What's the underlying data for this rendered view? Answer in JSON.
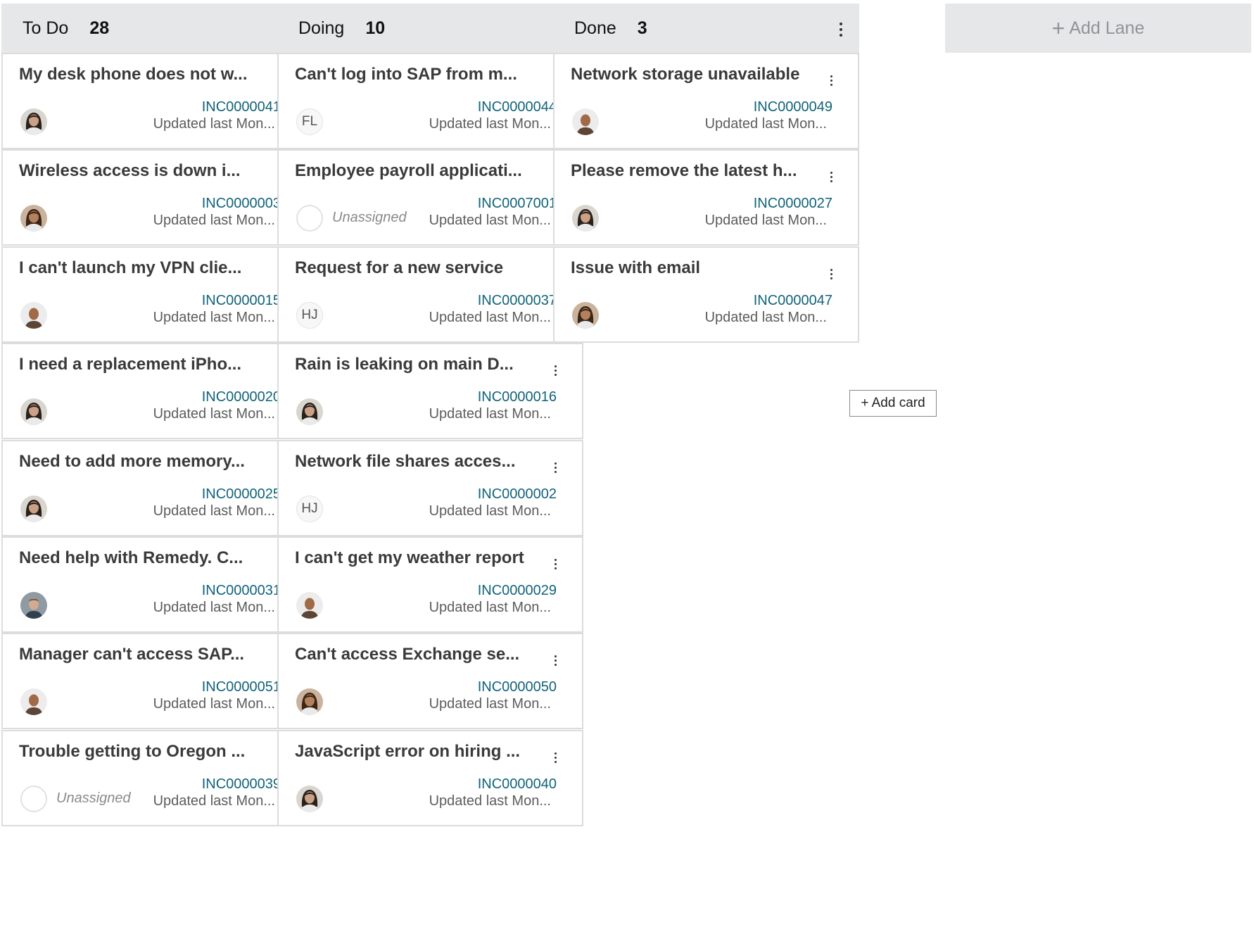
{
  "lanes": [
    {
      "title": "To Do",
      "count": "28",
      "cards": [
        {
          "title": "My desk phone does not w...",
          "number": "INC0000041",
          "updated": "Updated last Mon...",
          "avatar": {
            "type": "photo",
            "face": "woman-dark-hair"
          }
        },
        {
          "title": "Wireless access is down i...",
          "number": "INC0000003",
          "updated": "Updated last Mon...",
          "avatar": {
            "type": "photo",
            "face": "woman-smiling"
          }
        },
        {
          "title": "I can't launch my VPN clie...",
          "number": "INC0000015",
          "updated": "Updated last Mon...",
          "avatar": {
            "type": "photo",
            "face": "man-bald"
          }
        },
        {
          "title": "I need a replacement iPho...",
          "number": "INC0000020",
          "updated": "Updated last Mon...",
          "avatar": {
            "type": "photo",
            "face": "woman-dark-hair"
          }
        },
        {
          "title": "Need to add more memory...",
          "number": "INC0000025",
          "updated": "Updated last Mon...",
          "avatar": {
            "type": "photo",
            "face": "woman-dark-hair"
          }
        },
        {
          "title": "Need help with Remedy. C...",
          "number": "INC0000031",
          "updated": "Updated last Mon...",
          "avatar": {
            "type": "photo",
            "face": "man-suit"
          }
        },
        {
          "title": "Manager can't access SAP...",
          "number": "INC0000051",
          "updated": "Updated last Mon...",
          "avatar": {
            "type": "photo",
            "face": "man-bald"
          }
        },
        {
          "title": "Trouble getting to Oregon ...",
          "number": "INC0000039",
          "updated": "Updated last Mon...",
          "avatar": {
            "type": "unassigned",
            "label": "Unassigned"
          }
        }
      ]
    },
    {
      "title": "Doing",
      "count": "10",
      "cards": [
        {
          "title": "Can't log into SAP from m...",
          "number": "INC0000044",
          "updated": "Updated last Mon...",
          "avatar": {
            "type": "initials",
            "initials": "FL"
          }
        },
        {
          "title": "Employee payroll applicati...",
          "number": "INC0007001",
          "updated": "Updated last Mon...",
          "avatar": {
            "type": "unassigned",
            "label": "Unassigned"
          }
        },
        {
          "title": "Request for a new service",
          "number": "INC0000037",
          "updated": "Updated last Mon...",
          "avatar": {
            "type": "initials",
            "initials": "HJ"
          }
        },
        {
          "title": "Rain is leaking on main D...",
          "number": "INC0000016",
          "updated": "Updated last Mon...",
          "avatar": {
            "type": "photo",
            "face": "woman-dark-hair"
          }
        },
        {
          "title": "Network file shares acces...",
          "number": "INC0000002",
          "updated": "Updated last Mon...",
          "avatar": {
            "type": "initials",
            "initials": "HJ"
          }
        },
        {
          "title": "I can't get my weather report",
          "number": "INC0000029",
          "updated": "Updated last Mon...",
          "avatar": {
            "type": "photo",
            "face": "man-bald"
          }
        },
        {
          "title": "Can't access Exchange se...",
          "number": "INC0000050",
          "updated": "Updated last Mon...",
          "avatar": {
            "type": "photo",
            "face": "woman-smiling"
          }
        },
        {
          "title": "JavaScript error on hiring ...",
          "number": "INC0000040",
          "updated": "Updated last Mon...",
          "avatar": {
            "type": "photo",
            "face": "woman-dark-hair"
          }
        }
      ]
    },
    {
      "title": "Done",
      "count": "3",
      "cards": [
        {
          "title": "Network storage unavailable",
          "number": "INC0000049",
          "updated": "Updated last Mon...",
          "avatar": {
            "type": "photo",
            "face": "man-bald"
          }
        },
        {
          "title": "Please remove the latest h...",
          "number": "INC0000027",
          "updated": "Updated last Mon...",
          "avatar": {
            "type": "photo",
            "face": "woman-dark-hair"
          }
        },
        {
          "title": "Issue with email",
          "number": "INC0000047",
          "updated": "Updated last Mon...",
          "avatar": {
            "type": "photo",
            "face": "woman-smiling"
          }
        }
      ],
      "add_card_label": "+ Add card"
    }
  ],
  "add_lane": {
    "plus": "+",
    "label": "Add Lane"
  },
  "icons": {
    "lane_menu": "vertical-dots-icon",
    "card_menu": "vertical-dots-icon"
  },
  "colors": {
    "header_bg": "#e6e7e8",
    "card_border": "#dcdcdc",
    "number_link": "#10637a",
    "add_lane_text": "#8f9499"
  }
}
